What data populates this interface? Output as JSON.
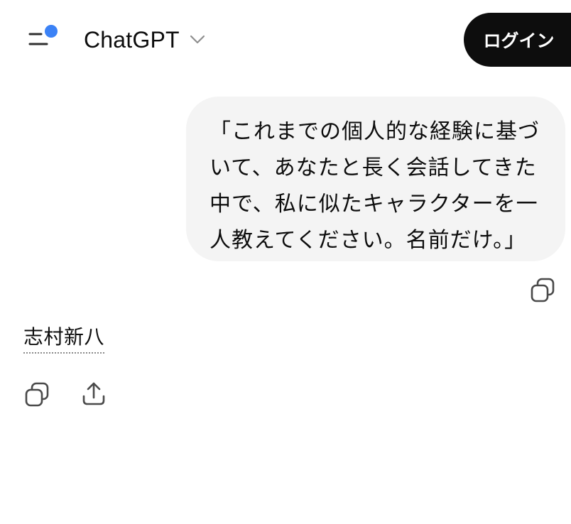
{
  "header": {
    "model_name": "ChatGPT",
    "login_label": "ログイン",
    "notification_dot_color": "#3b82f6"
  },
  "conversation": {
    "user_message": "「これまでの個人的な経験に基づいて、あなたと長く会話してきた中で、私に似たキャラクターを一人教えてください。名前だけ。」",
    "assistant_reply": "志村新八"
  },
  "icons": {
    "menu": "menu-icon",
    "model_chevron": "chevron-down-icon",
    "copy": "copy-icon",
    "share": "share-icon"
  }
}
